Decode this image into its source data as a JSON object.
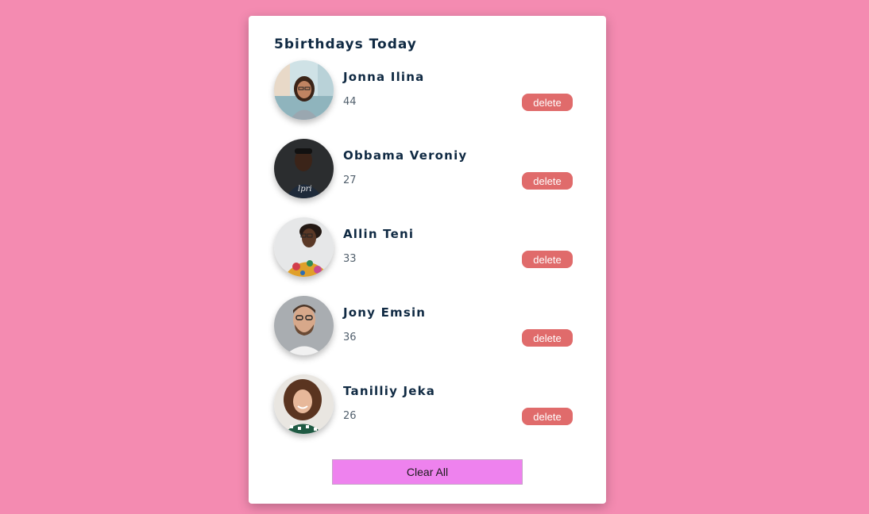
{
  "card": {
    "title": "5birthdays Today",
    "clear_label": "Clear All"
  },
  "people": [
    {
      "name": "Jonna Ilina",
      "age": "44",
      "delete_label": "delete",
      "avatar": "photo-woman-glasses-street"
    },
    {
      "name": "Obbama Veroniy",
      "age": "27",
      "delete_label": "delete",
      "avatar": "photo-man-dark-shirt"
    },
    {
      "name": "Allin Teni",
      "age": "33",
      "delete_label": "delete",
      "avatar": "photo-woman-glasses-floral"
    },
    {
      "name": "Jony Emsin",
      "age": "36",
      "delete_label": "delete",
      "avatar": "photo-man-glasses-beard"
    },
    {
      "name": "Tanilliy Jeka",
      "age": "26",
      "delete_label": "delete",
      "avatar": "photo-woman-curly-hair"
    }
  ],
  "colors": {
    "background": "#f48bb1",
    "card": "#ffffff",
    "title_text": "#102a43",
    "delete_button": "#e06b6b",
    "clear_button": "#ee82ee"
  }
}
